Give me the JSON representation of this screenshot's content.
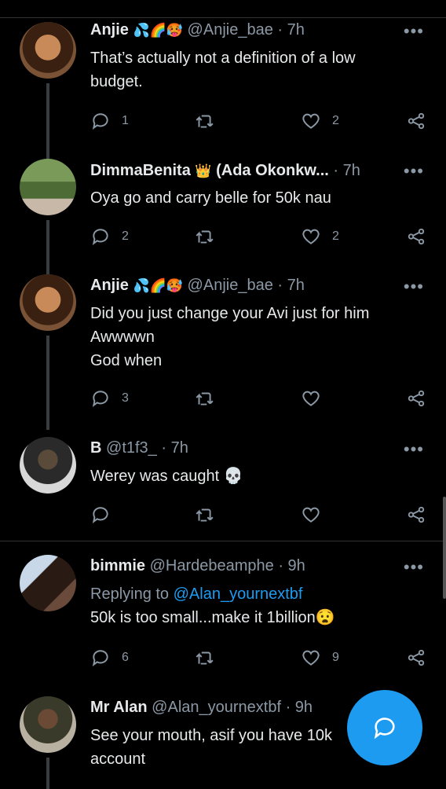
{
  "tweets": [
    {
      "name": "Anjie",
      "handle": "@Anjie_bae",
      "time": "· 7h",
      "text_lines": [
        "That’s actually not a definition of a low",
        "budget."
      ],
      "replies": "1",
      "retweets": "",
      "likes": "2"
    },
    {
      "name": "DimmaBenita",
      "handle": "(Ada Okonkw...",
      "time": "· 7h",
      "text_lines": [
        "Oya go and carry belle for 50k nau"
      ],
      "replies": "2",
      "retweets": "",
      "likes": "2"
    },
    {
      "name": "Anjie",
      "handle": "@Anjie_bae",
      "time": "· 7h",
      "text_lines": [
        "Did you just change your Avi just for him",
        "Awwwwn",
        "God when"
      ],
      "replies": "3",
      "retweets": "",
      "likes": ""
    },
    {
      "name": "B",
      "handle": "@t1f3_",
      "time": "· 7h",
      "text_lines": [
        "Werey was caught 💀"
      ],
      "replies": "",
      "retweets": "",
      "likes": ""
    },
    {
      "name": "bimmie",
      "handle": "@Hardebeamphe",
      "time": "· 9h",
      "replying_label": "Replying to",
      "replying_handle": "@Alan_yournextbf",
      "text_lines": [
        "50k is too small...make it 1billion😧"
      ],
      "replies": "6",
      "retweets": "",
      "likes": "9"
    },
    {
      "name": "Mr Alan",
      "handle": "@Alan_yournextbf",
      "time": "· 9h",
      "text_lines": [
        "See your mouth, asif you have 10k",
        "account"
      ],
      "replies": "",
      "retweets": "",
      "likes": ""
    }
  ],
  "emojis": {
    "anjie": "💦🌈🥵",
    "dimma": "👑"
  },
  "more_glyph": "•••",
  "colors": {
    "background": "#000000",
    "text": "#e7e9ea",
    "secondary": "#8b98a5",
    "accent": "#1d9bf0",
    "divider": "#2f3336"
  },
  "icons": {
    "reply": "reply-icon",
    "retweet": "retweet-icon",
    "like": "heart-icon",
    "share": "share-icon",
    "compose": "compose-reply-icon"
  }
}
